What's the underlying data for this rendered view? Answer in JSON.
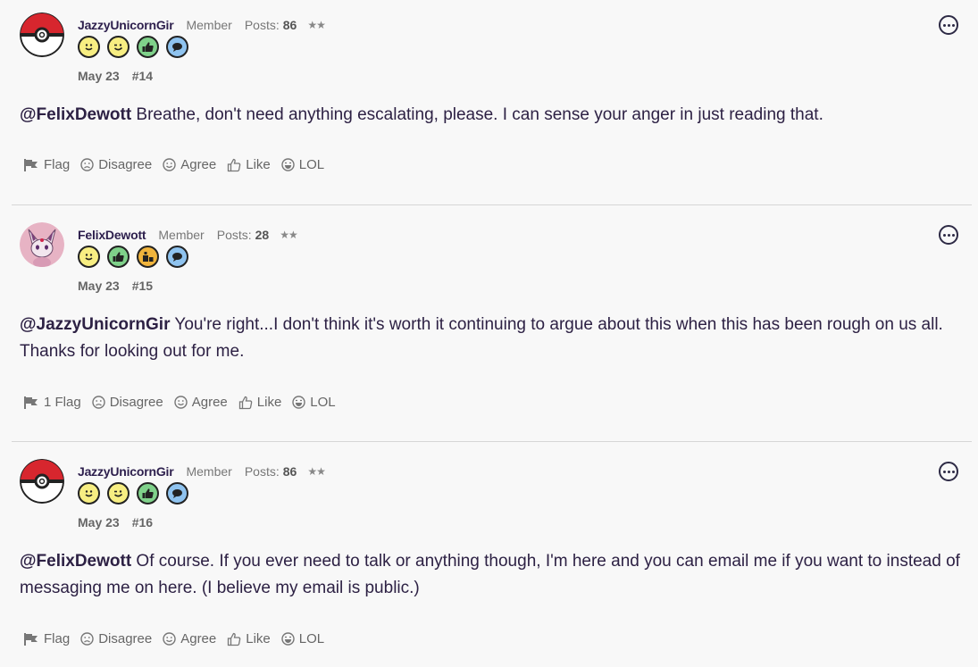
{
  "posts": [
    {
      "username": "JazzyUnicornGir",
      "role": "Member",
      "posts_label": "Posts:",
      "posts_count": "86",
      "stars": "★★",
      "date": "May 23",
      "post_number": "#14",
      "mention": "@FelixDewott",
      "text": " Breathe, don't need anything escalating, please. I can sense your anger in just reading that.",
      "avatar": "pokeball",
      "badges": [
        "smile-face-icon",
        "wink-face-icon",
        "thumbs-up-icon",
        "speech-bubble-icon"
      ],
      "actions": {
        "flag": "Flag",
        "disagree": "Disagree",
        "agree": "Agree",
        "like": "Like",
        "lol": "LOL"
      }
    },
    {
      "username": "FelixDewott",
      "role": "Member",
      "posts_label": "Posts:",
      "posts_count": "28",
      "stars": "★★",
      "date": "May 23",
      "post_number": "#15",
      "mention": "@JazzyUnicornGir",
      "text": " You're right...I don't think it's worth it continuing to argue about this when this has been rough on us all. Thanks for looking out for me.",
      "avatar": "espeon",
      "badges": [
        "smile-face-icon",
        "thumbs-up-icon",
        "trophy-icon",
        "speech-bubble-icon"
      ],
      "actions": {
        "flag": "1 Flag",
        "disagree": "Disagree",
        "agree": "Agree",
        "like": "Like",
        "lol": "LOL"
      }
    },
    {
      "username": "JazzyUnicornGir",
      "role": "Member",
      "posts_label": "Posts:",
      "posts_count": "86",
      "stars": "★★",
      "date": "May 23",
      "post_number": "#16",
      "mention": "@FelixDewott",
      "text": " Of course. If you ever need to talk or anything though, I'm here and you can email me if you want to instead of messaging me on here. (I believe my email is public.)",
      "avatar": "pokeball",
      "badges": [
        "smile-face-icon",
        "wink-face-icon",
        "thumbs-up-icon",
        "speech-bubble-icon"
      ],
      "actions": {
        "flag": "Flag",
        "disagree": "Disagree",
        "agree": "Agree",
        "like": "Like",
        "lol": "LOL"
      }
    }
  ],
  "colors": {
    "background": "#f8f8f8",
    "text": "#2d2144",
    "badge_yellow": "#f7ee82",
    "badge_green": "#7fd18a",
    "badge_blue": "#8fc3ef",
    "badge_orange": "#f0b43c",
    "separator": "#d6d6d6"
  }
}
